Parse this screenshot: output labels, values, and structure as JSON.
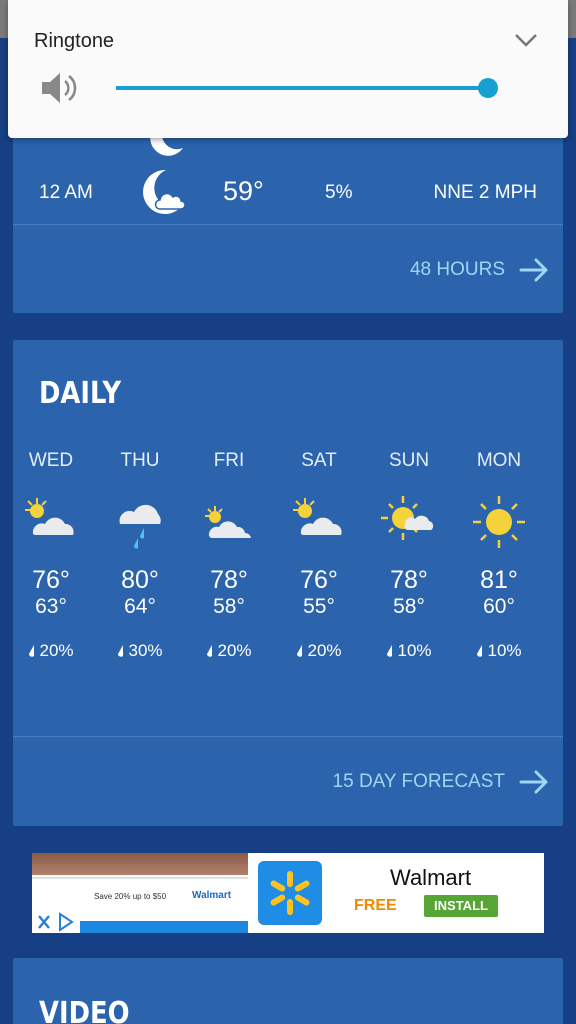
{
  "volume": {
    "title": "Ringtone",
    "level": 1.0,
    "accent_color": "#19a0d3"
  },
  "hourly": {
    "rows": [
      {
        "time": "12 AM",
        "icon": "moon-cloud-icon",
        "temp": "59°",
        "precip": "5%",
        "wind": "NNE 2 MPH"
      }
    ],
    "more_link": "48 HOURS"
  },
  "daily": {
    "title": "DAILY",
    "days": [
      {
        "day": "WED",
        "icon": "partly-cloudy-icon",
        "high": "76°",
        "low": "63°",
        "precip": "20%"
      },
      {
        "day": "THU",
        "icon": "rain-icon",
        "high": "80°",
        "low": "64°",
        "precip": "30%"
      },
      {
        "day": "FRI",
        "icon": "partly-cloudy-icon",
        "high": "78°",
        "low": "58°",
        "precip": "20%"
      },
      {
        "day": "SAT",
        "icon": "partly-cloudy-icon",
        "high": "76°",
        "low": "55°",
        "precip": "20%"
      },
      {
        "day": "SUN",
        "icon": "mostly-sunny-icon",
        "high": "78°",
        "low": "58°",
        "precip": "10%"
      },
      {
        "day": "MON",
        "icon": "sunny-icon",
        "high": "81°",
        "low": "60°",
        "precip": "10%"
      }
    ],
    "more_link": "15 DAY FORECAST"
  },
  "ad": {
    "banner_text": "Save 20% up to $50",
    "banner_brand": "Walmart",
    "title": "Walmart",
    "price": "FREE",
    "cta": "INSTALL"
  },
  "video": {
    "title": "VIDEO"
  }
}
